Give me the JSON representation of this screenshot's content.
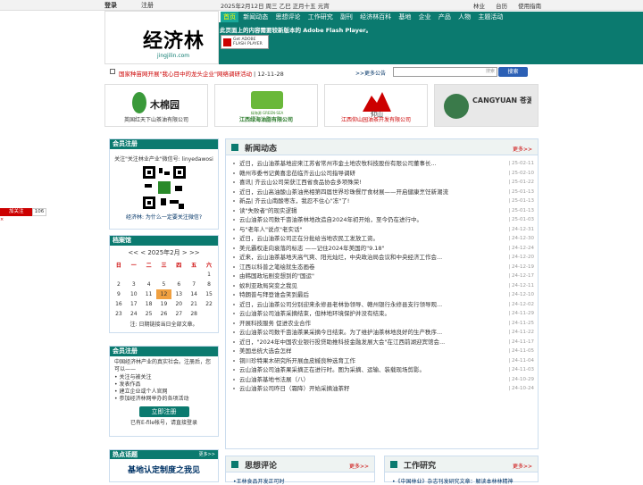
{
  "topbar": {
    "login": "登录",
    "register": "注册",
    "date": "2025年2月12日 周三  乙巳 正月十五 元宵",
    "links": [
      "林业",
      "台历",
      "使用指南"
    ]
  },
  "nav": [
    "首页",
    "新闻动态",
    "思想评论",
    "工作研究",
    "副刊",
    "经济林百科",
    "基地",
    "企业",
    "产品",
    "人物",
    "主题活动"
  ],
  "logo": {
    "name": "经济林",
    "url": "jingjilin.com"
  },
  "flash": {
    "message": "此页面上的内容需要较新版本的 Adobe Flash Player。",
    "button": "Get ADOBE FLASH PLAYER"
  },
  "headline": {
    "text": "国家种苗网开展\"我心目中的龙头企业\"网络调研活动",
    "time": " | 12-11-28",
    "more": ">>更多公告"
  },
  "search": {
    "placeholder": "搜索",
    "button": "搜索"
  },
  "ads": [
    {
      "brand": "木棉园",
      "caption": "英国红天下山茶油有限公司"
    },
    {
      "brand": "绿海源 GREEN-SEA",
      "caption": "江西绿海油脂有限公司"
    },
    {
      "brand": "仰山",
      "caption": "江西仰山园油茶开发有限公司"
    },
    {
      "brand": "CANGYUAN 苍源",
      "caption": ""
    }
  ],
  "member1": {
    "title": "会员注册",
    "text": "关注\"关注林业产业\"微信号: linyedawosi",
    "bottom": "经济林: 为什么一定要关注微信?"
  },
  "share": {
    "label": "加关注",
    "count": "106",
    "close": "×"
  },
  "archive": {
    "title": "档案馆",
    "nav": "<< <  2025年2月  > >>",
    "weekdays": [
      "日",
      "一",
      "二",
      "三",
      "四",
      "五",
      "六"
    ],
    "rows": [
      [
        "",
        "",
        "",
        "",
        "",
        "",
        "1"
      ],
      [
        "2",
        "3",
        "4",
        "5",
        "6",
        "7",
        "8"
      ],
      [
        "9",
        "10",
        "11",
        "12",
        "13",
        "14",
        "15"
      ],
      [
        "16",
        "17",
        "18",
        "19",
        "20",
        "21",
        "22"
      ],
      [
        "23",
        "24",
        "25",
        "26",
        "27",
        "28",
        ""
      ]
    ],
    "today": "12",
    "note": "注: 日期链接当日全部文章。"
  },
  "member2": {
    "title": "会员注册",
    "intro": "中国经济林产业的真实社会。注册后，您可以——",
    "items": [
      "• 关注与被关注",
      "• 发表作品",
      "• 建立企业或个人官网",
      "• 参加经济林网举办的各项活动"
    ],
    "button": "立即注册",
    "footer": "已有E-file帐号，请直接登录"
  },
  "hot": {
    "title": "热点话题",
    "more": "更多>>",
    "topic": "基地认定制度之我见"
  },
  "news": {
    "title": "新闻动态",
    "more": "更多>>",
    "items": [
      {
        "t": "近日，云山油茶基地迎来江苏省常州市金土地农牧科技股份有限公司董事长...",
        "d": "| 25-02-11"
      },
      {
        "t": "赣州市委书记黄喜忠莅临齐云山公司指导调研",
        "d": "| 25-02-10"
      },
      {
        "t": "喜讯| 齐云山公司荣获江西省食品协会多项殊荣!",
        "d": "| 25-01-22"
      },
      {
        "t": "近日，云山高油酸山茶油亮相第四届世界珍珠餐厅食材展——开启健康烹饪新潮流",
        "d": "| 25-01-13"
      },
      {
        "t": "新品| 齐云山南酸枣冻，我忍不住心\"冻\"了!",
        "d": "| 25-01-13"
      },
      {
        "t": "读\"失败者\"的现实逻辑",
        "d": "| 25-01-13"
      },
      {
        "t": "云山油茶公司数千亩油茶林地改造自2024年初开始，至今仍在进行中。",
        "d": "| 25-01-03"
      },
      {
        "t": "与\"老年人\"说点\"老实话\"",
        "d": "| 24-12-31"
      },
      {
        "t": "近日，云山油茶公司正在分批给当地农民工发放工资。",
        "d": "| 24-12-30"
      },
      {
        "t": "美元霸权走向衰落的标志 ——记住2024年美国的\"9.18\"",
        "d": "| 24-12-24"
      },
      {
        "t": "近来，云山油茶基地天高气爽、阳光灿烂，中央政治局会议和中央经济工作会...",
        "d": "| 24-12-20"
      },
      {
        "t": "江西以科普之笔绘就生态画卷",
        "d": "| 24-12-19"
      },
      {
        "t": "由韩国政坛剧变想到的\"国运\"",
        "d": "| 24-12-17"
      },
      {
        "t": "蚁利亚政局突变之我见",
        "d": "| 24-12-11"
      },
      {
        "t": "特朗普与拜登谁会笑到最后",
        "d": "| 24-12-10"
      },
      {
        "t": "近日，云山油茶公司分别迎来永修县老林协领导、赣州银行永修县支行领导观...",
        "d": "| 24-12-02"
      },
      {
        "t": "云山油茶公司油茶采摘结束，但林地环境保护并没有结束。",
        "d": "| 24-11-29"
      },
      {
        "t": "开展科技服务 促进农业合作",
        "d": "| 24-11-25"
      },
      {
        "t": "云山油茶公司数千亩油茶果采摘今日结束。为了维护油茶林地良好的生产秩序...",
        "d": "| 24-11-22"
      },
      {
        "t": "近日，\"2024年中国农业银行投贷助推科技金融发展大会\"在江西前湖迎宾馆会...",
        "d": "| 24-11-17"
      },
      {
        "t": "美国总统大选会怎样",
        "d": "| 24-11-05"
      },
      {
        "t": "铜川珍特果木研究所开展血皮槭良种选育工作",
        "d": "| 24-11-04"
      },
      {
        "t": "云山油茶公司油茶果采摘正在进行时。图为采摘、运输、装载现场剪影。",
        "d": "| 24-11-03"
      },
      {
        "t": "云山油茶基地书法展（八）",
        "d": "| 24-10-29"
      },
      {
        "t": "云山油茶公司昨日（霜降）开始采摘油茶籽",
        "d": "| 24-10-24"
      }
    ]
  },
  "sub1": {
    "title": "思想评论",
    "more": "更多>>",
    "line": "•王林食品开发正可时"
  },
  "sub2": {
    "title": "工作研究",
    "more": "更多>>",
    "line": "•《中国林业》杂志刊发研究文章：解读本林林精神"
  }
}
